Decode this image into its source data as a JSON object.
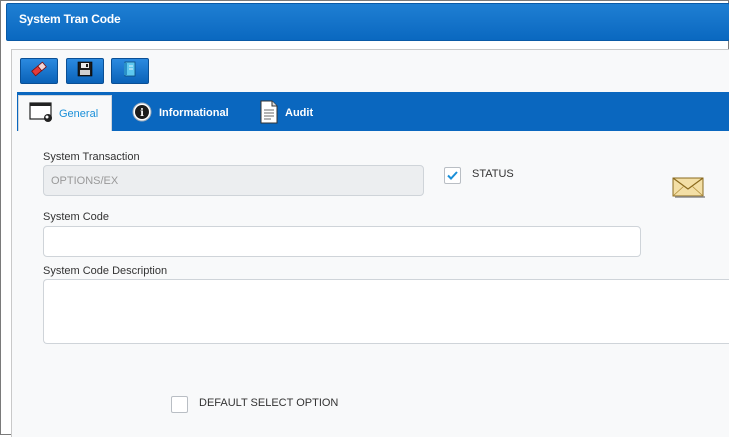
{
  "window": {
    "title": "System Tran Code"
  },
  "toolbar": {
    "buttons": [
      {
        "icon": "eraser-icon",
        "label": ""
      },
      {
        "icon": "save-icon",
        "label": ""
      },
      {
        "icon": "notebook-icon",
        "label": ""
      }
    ]
  },
  "tabs": [
    {
      "label": "General",
      "icon": "window-icon",
      "active": true
    },
    {
      "label": "Informational",
      "icon": "info-icon",
      "active": false
    },
    {
      "label": "Audit",
      "icon": "document-icon",
      "active": false
    }
  ],
  "form": {
    "system_transaction": {
      "label": "System Transaction",
      "value": "OPTIONS/EX"
    },
    "status": {
      "label": "STATUS",
      "checked": true
    },
    "system_code": {
      "label": "System Code",
      "value": ""
    },
    "system_code_description": {
      "label": "System Code Description",
      "value": ""
    },
    "default_select_option": {
      "label": "DEFAULT SELECT OPTION",
      "checked": false
    },
    "mail_icon": "envelope-icon"
  },
  "colors": {
    "brand_blue": "#0a67bf",
    "tab_active_text": "#1a8fd8",
    "check_color": "#1a8fd8"
  }
}
